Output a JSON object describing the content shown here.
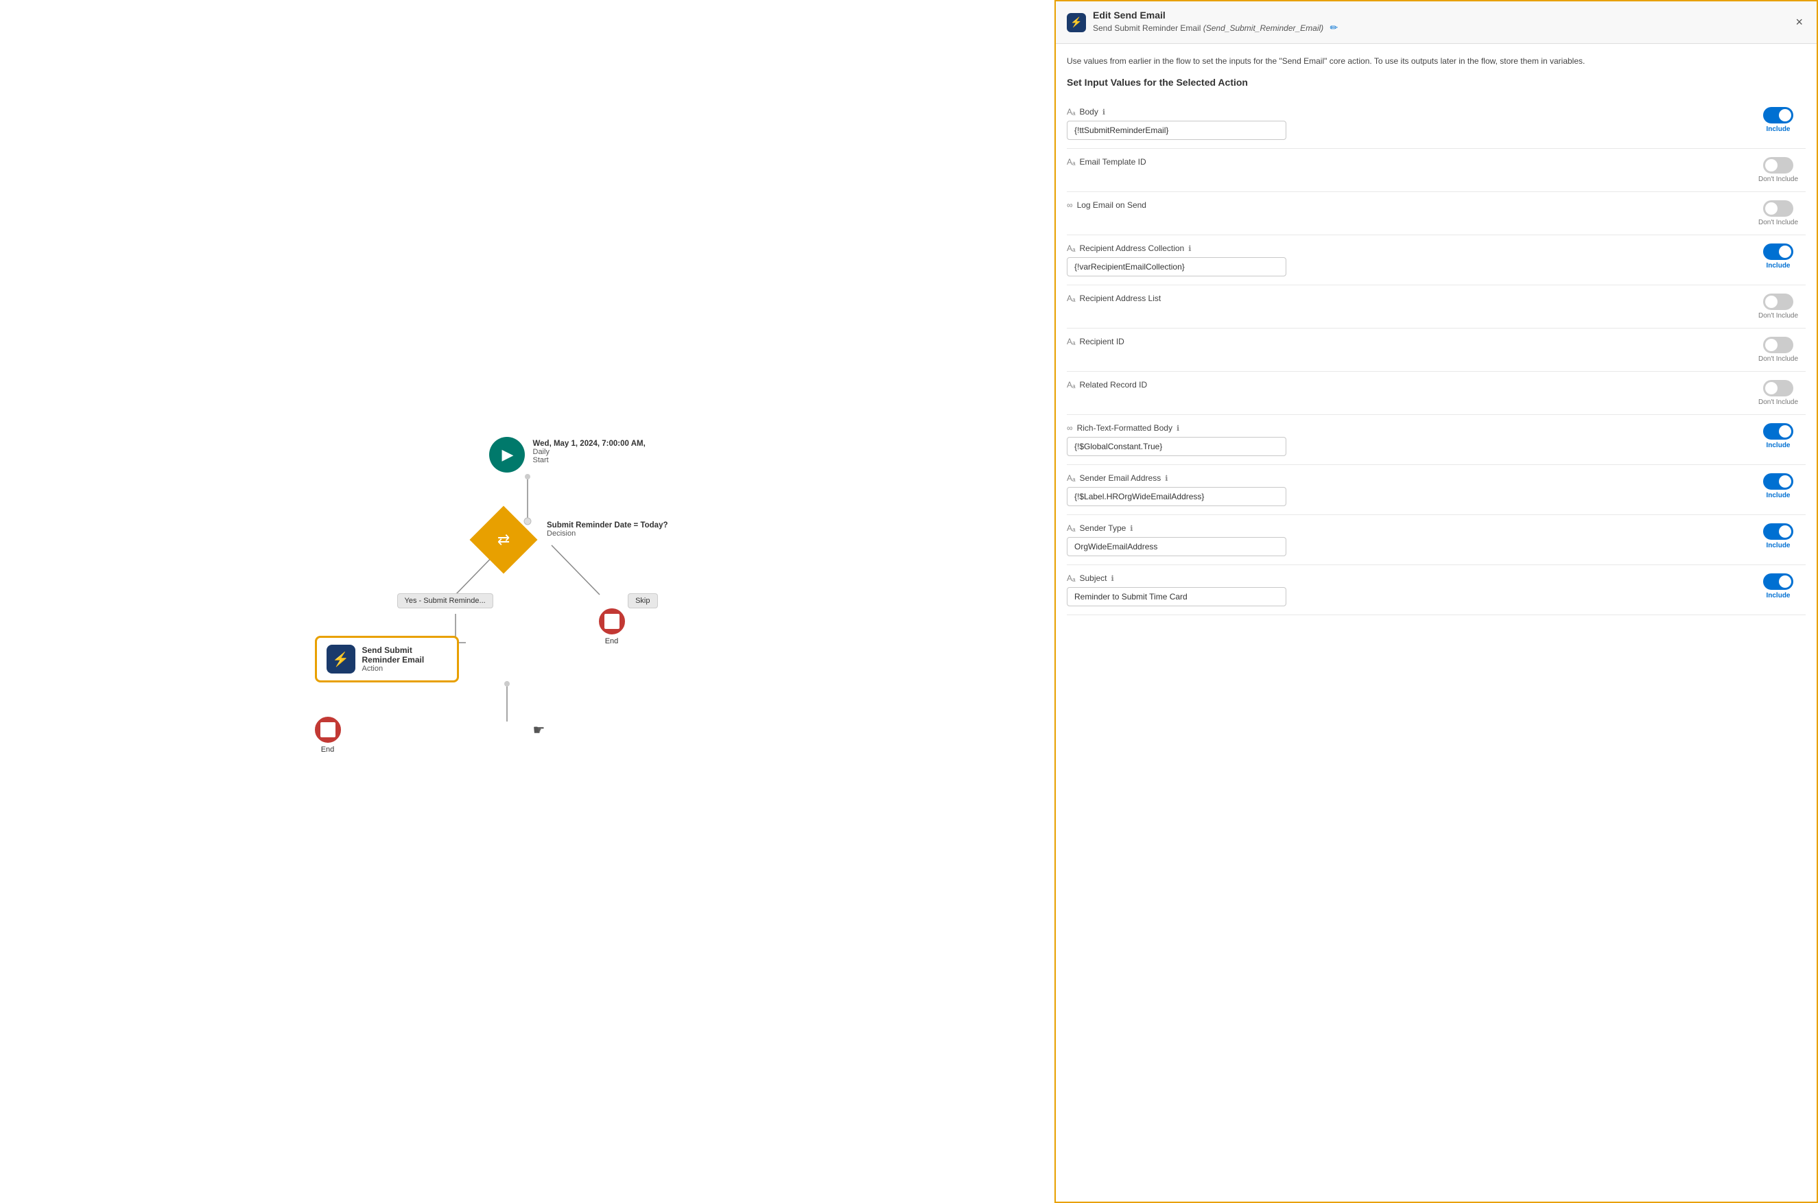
{
  "flow": {
    "start_node": {
      "date": "Wed, May 1, 2024, 7:00:00 AM,",
      "frequency": "Daily",
      "label": "Start"
    },
    "decision_node": {
      "label": "Submit Reminder Date = Today?",
      "type": "Decision"
    },
    "branch_yes": "Yes - Submit Reminde...",
    "branch_skip": "Skip",
    "action_node": {
      "name": "Send Submit Reminder Email",
      "type": "Action"
    },
    "end_right": "End",
    "end_bottom": "End"
  },
  "panel": {
    "title": "Edit Send Email",
    "subtitle_prefix": "Send Submit Reminder Email",
    "subtitle_italic": "(Send_Submit_Reminder_Email)",
    "description": "Use values from earlier in the flow to set the inputs for the \"Send Email\" core action. To use its outputs later in the flow, store them in variables.",
    "section_title": "Set Input Values for the Selected Action",
    "fields": [
      {
        "id": "body",
        "icon": "text",
        "label": "Body",
        "has_info": true,
        "value": "{!ttSubmitReminderEmail}",
        "has_input": true,
        "toggle_on": true,
        "toggle_text_on": "Include",
        "toggle_text_off": "Don't Include"
      },
      {
        "id": "email_template_id",
        "icon": "text",
        "label": "Email Template ID",
        "has_info": false,
        "value": "",
        "has_input": false,
        "toggle_on": false,
        "toggle_text_on": "Include",
        "toggle_text_off": "Don't Include"
      },
      {
        "id": "log_email_on_send",
        "icon": "link",
        "label": "Log Email on Send",
        "has_info": false,
        "value": "",
        "has_input": false,
        "toggle_on": false,
        "toggle_text_on": "Include",
        "toggle_text_off": "Don't Include"
      },
      {
        "id": "recipient_address_collection",
        "icon": "text",
        "label": "Recipient Address Collection",
        "has_info": true,
        "value": "{!varRecipientEmailCollection}",
        "has_input": true,
        "toggle_on": true,
        "toggle_text_on": "Include",
        "toggle_text_off": "Don't Include"
      },
      {
        "id": "recipient_address_list",
        "icon": "text",
        "label": "Recipient Address List",
        "has_info": false,
        "value": "",
        "has_input": false,
        "toggle_on": false,
        "toggle_text_on": "Include",
        "toggle_text_off": "Don't Include"
      },
      {
        "id": "recipient_id",
        "icon": "text",
        "label": "Recipient ID",
        "has_info": false,
        "value": "",
        "has_input": false,
        "toggle_on": false,
        "toggle_text_on": "Include",
        "toggle_text_off": "Don't Include"
      },
      {
        "id": "related_record_id",
        "icon": "text",
        "label": "Related Record ID",
        "has_info": false,
        "value": "",
        "has_input": false,
        "toggle_on": false,
        "toggle_text_on": "Include",
        "toggle_text_off": "Don't Include"
      },
      {
        "id": "rich_text_formatted_body",
        "icon": "link",
        "label": "Rich-Text-Formatted Body",
        "has_info": true,
        "value": "{!$GlobalConstant.True}",
        "has_input": true,
        "toggle_on": true,
        "toggle_text_on": "Include",
        "toggle_text_off": "Don't Include"
      },
      {
        "id": "sender_email_address",
        "icon": "text",
        "label": "Sender Email Address",
        "has_info": true,
        "value": "{!$Label.HROrgWideEmailAddress}",
        "has_input": true,
        "toggle_on": true,
        "toggle_text_on": "Include",
        "toggle_text_off": "Don't Include"
      },
      {
        "id": "sender_type",
        "icon": "text",
        "label": "Sender Type",
        "has_info": true,
        "value": "OrgWideEmailAddress",
        "has_input": true,
        "toggle_on": true,
        "toggle_text_on": "Include",
        "toggle_text_off": "Don't Include"
      },
      {
        "id": "subject",
        "icon": "text",
        "label": "Subject",
        "has_info": true,
        "value": "Reminder to Submit Time Card",
        "has_input": true,
        "toggle_on": true,
        "toggle_text_on": "Include",
        "toggle_text_off": "Don't Include"
      }
    ],
    "close_icon": "×",
    "edit_icon": "✏"
  },
  "colors": {
    "teal": "#00796b",
    "orange": "#e8a000",
    "red": "#c23934",
    "blue": "#1a3a6b",
    "salesforce_blue": "#0070d2"
  }
}
